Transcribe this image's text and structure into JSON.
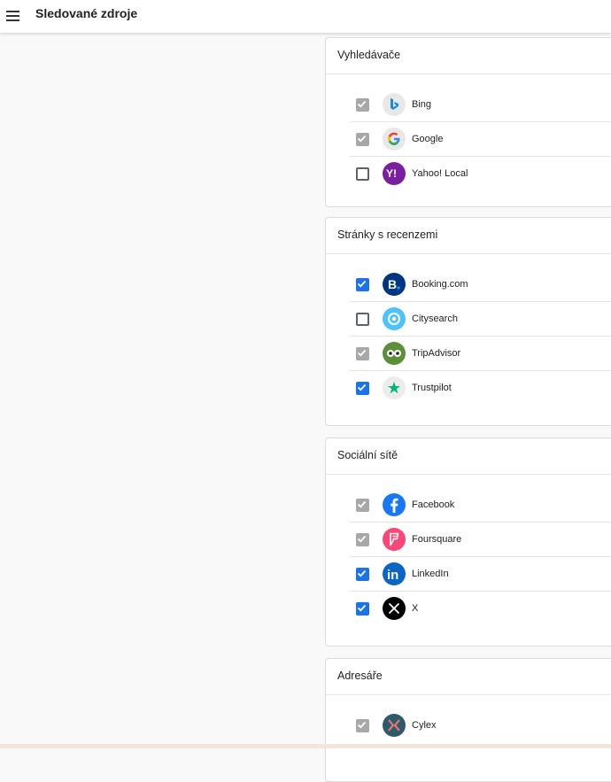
{
  "header": {
    "title": "Sledované zdroje",
    "menu_icon": "hamburger-menu-icon"
  },
  "colors": {
    "checked": "#1a73e8",
    "disabled_checked": "#a8a8a8",
    "unchecked_border": "#5f6368"
  },
  "sections": [
    {
      "title": "Vyhledávače",
      "items": [
        {
          "name": "Bing",
          "state": "disabled-checked",
          "icon": "bing-icon"
        },
        {
          "name": "Google",
          "state": "disabled-checked",
          "icon": "google-icon"
        },
        {
          "name": "Yahoo! Local",
          "state": "unchecked",
          "icon": "yahoo-icon"
        }
      ]
    },
    {
      "title": "Stránky s recenzemi",
      "items": [
        {
          "name": "Booking.com",
          "state": "checked",
          "icon": "booking-icon"
        },
        {
          "name": "Citysearch",
          "state": "unchecked",
          "icon": "citysearch-icon"
        },
        {
          "name": "TripAdvisor",
          "state": "disabled-checked",
          "icon": "tripadvisor-icon"
        },
        {
          "name": "Trustpilot",
          "state": "checked",
          "icon": "trustpilot-icon"
        }
      ]
    },
    {
      "title": "Sociální sítě",
      "items": [
        {
          "name": "Facebook",
          "state": "disabled-checked",
          "icon": "facebook-icon"
        },
        {
          "name": "Foursquare",
          "state": "disabled-checked",
          "icon": "foursquare-icon"
        },
        {
          "name": "LinkedIn",
          "state": "checked",
          "icon": "linkedin-icon"
        },
        {
          "name": "X",
          "state": "checked",
          "icon": "x-icon"
        }
      ]
    },
    {
      "title": "Adresáře",
      "items": [
        {
          "name": "Cylex",
          "state": "disabled-checked",
          "icon": "cylex-icon"
        }
      ]
    }
  ]
}
